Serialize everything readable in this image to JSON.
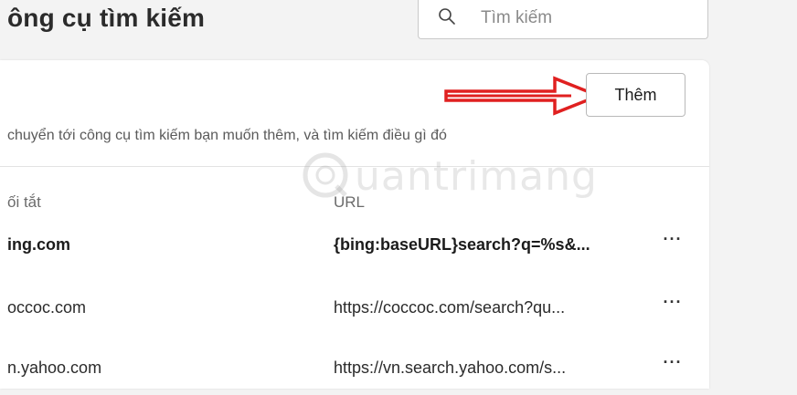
{
  "header": {
    "title": "ông cụ tìm kiếm",
    "search_placeholder": "Tìm kiếm"
  },
  "card": {
    "add_label": "Thêm",
    "description": "chuyển tới công cụ tìm kiếm bạn muốn thêm, và tìm kiếm điều gì đó",
    "columns": {
      "shortcut": "ối tắt",
      "url": "URL"
    },
    "rows": [
      {
        "shortcut": "ing.com",
        "url": "{bing:baseURL}search?q=%s&...",
        "more": "···"
      },
      {
        "shortcut": "occoc.com",
        "url": "https://coccoc.com/search?qu...",
        "more": "···"
      },
      {
        "shortcut": "n.yahoo.com",
        "url": "https://vn.search.yahoo.com/s...",
        "more": "···"
      }
    ]
  },
  "annotation": {
    "arrow_color": "#e02020"
  },
  "watermark": {
    "text": "uantrimang"
  }
}
